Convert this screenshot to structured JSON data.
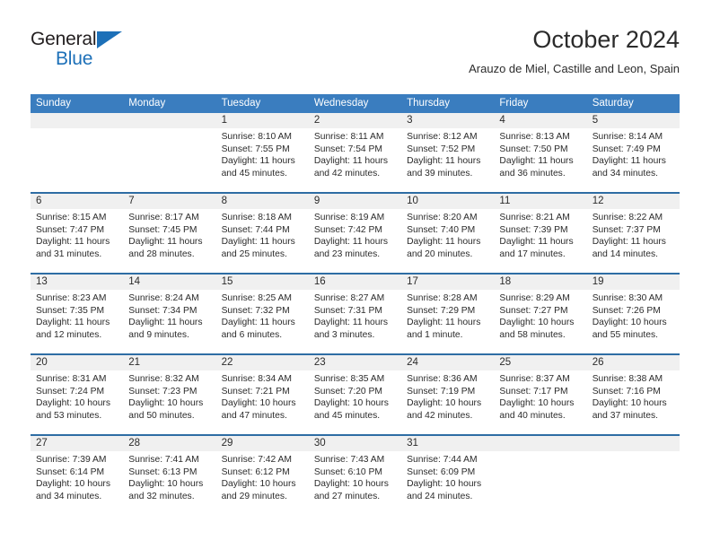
{
  "logo": {
    "word_top": "General",
    "word_bottom": "Blue",
    "triangle_color": "#1d70b8",
    "text_color": "#231f20"
  },
  "header": {
    "title": "October 2024",
    "subtitle": "Arauzo de Miel, Castille and Leon, Spain"
  },
  "theme": {
    "header_bg": "#3a7dbf",
    "header_text": "#ffffff",
    "row_divider": "#2e6da4",
    "daynum_band": "#f0f0f0",
    "body_text": "#2b2b2b"
  },
  "weekdays": [
    "Sunday",
    "Monday",
    "Tuesday",
    "Wednesday",
    "Thursday",
    "Friday",
    "Saturday"
  ],
  "weeks": [
    [
      {
        "day": "",
        "empty": true,
        "sunrise": "",
        "sunset": "",
        "daylight_line1": "",
        "daylight_line2": ""
      },
      {
        "day": "",
        "empty": true,
        "sunrise": "",
        "sunset": "",
        "daylight_line1": "",
        "daylight_line2": ""
      },
      {
        "day": "1",
        "sunrise": "Sunrise: 8:10 AM",
        "sunset": "Sunset: 7:55 PM",
        "daylight_line1": "Daylight: 11 hours",
        "daylight_line2": "and 45 minutes."
      },
      {
        "day": "2",
        "sunrise": "Sunrise: 8:11 AM",
        "sunset": "Sunset: 7:54 PM",
        "daylight_line1": "Daylight: 11 hours",
        "daylight_line2": "and 42 minutes."
      },
      {
        "day": "3",
        "sunrise": "Sunrise: 8:12 AM",
        "sunset": "Sunset: 7:52 PM",
        "daylight_line1": "Daylight: 11 hours",
        "daylight_line2": "and 39 minutes."
      },
      {
        "day": "4",
        "sunrise": "Sunrise: 8:13 AM",
        "sunset": "Sunset: 7:50 PM",
        "daylight_line1": "Daylight: 11 hours",
        "daylight_line2": "and 36 minutes."
      },
      {
        "day": "5",
        "sunrise": "Sunrise: 8:14 AM",
        "sunset": "Sunset: 7:49 PM",
        "daylight_line1": "Daylight: 11 hours",
        "daylight_line2": "and 34 minutes."
      }
    ],
    [
      {
        "day": "6",
        "sunrise": "Sunrise: 8:15 AM",
        "sunset": "Sunset: 7:47 PM",
        "daylight_line1": "Daylight: 11 hours",
        "daylight_line2": "and 31 minutes."
      },
      {
        "day": "7",
        "sunrise": "Sunrise: 8:17 AM",
        "sunset": "Sunset: 7:45 PM",
        "daylight_line1": "Daylight: 11 hours",
        "daylight_line2": "and 28 minutes."
      },
      {
        "day": "8",
        "sunrise": "Sunrise: 8:18 AM",
        "sunset": "Sunset: 7:44 PM",
        "daylight_line1": "Daylight: 11 hours",
        "daylight_line2": "and 25 minutes."
      },
      {
        "day": "9",
        "sunrise": "Sunrise: 8:19 AM",
        "sunset": "Sunset: 7:42 PM",
        "daylight_line1": "Daylight: 11 hours",
        "daylight_line2": "and 23 minutes."
      },
      {
        "day": "10",
        "sunrise": "Sunrise: 8:20 AM",
        "sunset": "Sunset: 7:40 PM",
        "daylight_line1": "Daylight: 11 hours",
        "daylight_line2": "and 20 minutes."
      },
      {
        "day": "11",
        "sunrise": "Sunrise: 8:21 AM",
        "sunset": "Sunset: 7:39 PM",
        "daylight_line1": "Daylight: 11 hours",
        "daylight_line2": "and 17 minutes."
      },
      {
        "day": "12",
        "sunrise": "Sunrise: 8:22 AM",
        "sunset": "Sunset: 7:37 PM",
        "daylight_line1": "Daylight: 11 hours",
        "daylight_line2": "and 14 minutes."
      }
    ],
    [
      {
        "day": "13",
        "sunrise": "Sunrise: 8:23 AM",
        "sunset": "Sunset: 7:35 PM",
        "daylight_line1": "Daylight: 11 hours",
        "daylight_line2": "and 12 minutes."
      },
      {
        "day": "14",
        "sunrise": "Sunrise: 8:24 AM",
        "sunset": "Sunset: 7:34 PM",
        "daylight_line1": "Daylight: 11 hours",
        "daylight_line2": "and 9 minutes."
      },
      {
        "day": "15",
        "sunrise": "Sunrise: 8:25 AM",
        "sunset": "Sunset: 7:32 PM",
        "daylight_line1": "Daylight: 11 hours",
        "daylight_line2": "and 6 minutes."
      },
      {
        "day": "16",
        "sunrise": "Sunrise: 8:27 AM",
        "sunset": "Sunset: 7:31 PM",
        "daylight_line1": "Daylight: 11 hours",
        "daylight_line2": "and 3 minutes."
      },
      {
        "day": "17",
        "sunrise": "Sunrise: 8:28 AM",
        "sunset": "Sunset: 7:29 PM",
        "daylight_line1": "Daylight: 11 hours",
        "daylight_line2": "and 1 minute."
      },
      {
        "day": "18",
        "sunrise": "Sunrise: 8:29 AM",
        "sunset": "Sunset: 7:27 PM",
        "daylight_line1": "Daylight: 10 hours",
        "daylight_line2": "and 58 minutes."
      },
      {
        "day": "19",
        "sunrise": "Sunrise: 8:30 AM",
        "sunset": "Sunset: 7:26 PM",
        "daylight_line1": "Daylight: 10 hours",
        "daylight_line2": "and 55 minutes."
      }
    ],
    [
      {
        "day": "20",
        "sunrise": "Sunrise: 8:31 AM",
        "sunset": "Sunset: 7:24 PM",
        "daylight_line1": "Daylight: 10 hours",
        "daylight_line2": "and 53 minutes."
      },
      {
        "day": "21",
        "sunrise": "Sunrise: 8:32 AM",
        "sunset": "Sunset: 7:23 PM",
        "daylight_line1": "Daylight: 10 hours",
        "daylight_line2": "and 50 minutes."
      },
      {
        "day": "22",
        "sunrise": "Sunrise: 8:34 AM",
        "sunset": "Sunset: 7:21 PM",
        "daylight_line1": "Daylight: 10 hours",
        "daylight_line2": "and 47 minutes."
      },
      {
        "day": "23",
        "sunrise": "Sunrise: 8:35 AM",
        "sunset": "Sunset: 7:20 PM",
        "daylight_line1": "Daylight: 10 hours",
        "daylight_line2": "and 45 minutes."
      },
      {
        "day": "24",
        "sunrise": "Sunrise: 8:36 AM",
        "sunset": "Sunset: 7:19 PM",
        "daylight_line1": "Daylight: 10 hours",
        "daylight_line2": "and 42 minutes."
      },
      {
        "day": "25",
        "sunrise": "Sunrise: 8:37 AM",
        "sunset": "Sunset: 7:17 PM",
        "daylight_line1": "Daylight: 10 hours",
        "daylight_line2": "and 40 minutes."
      },
      {
        "day": "26",
        "sunrise": "Sunrise: 8:38 AM",
        "sunset": "Sunset: 7:16 PM",
        "daylight_line1": "Daylight: 10 hours",
        "daylight_line2": "and 37 minutes."
      }
    ],
    [
      {
        "day": "27",
        "sunrise": "Sunrise: 7:39 AM",
        "sunset": "Sunset: 6:14 PM",
        "daylight_line1": "Daylight: 10 hours",
        "daylight_line2": "and 34 minutes."
      },
      {
        "day": "28",
        "sunrise": "Sunrise: 7:41 AM",
        "sunset": "Sunset: 6:13 PM",
        "daylight_line1": "Daylight: 10 hours",
        "daylight_line2": "and 32 minutes."
      },
      {
        "day": "29",
        "sunrise": "Sunrise: 7:42 AM",
        "sunset": "Sunset: 6:12 PM",
        "daylight_line1": "Daylight: 10 hours",
        "daylight_line2": "and 29 minutes."
      },
      {
        "day": "30",
        "sunrise": "Sunrise: 7:43 AM",
        "sunset": "Sunset: 6:10 PM",
        "daylight_line1": "Daylight: 10 hours",
        "daylight_line2": "and 27 minutes."
      },
      {
        "day": "31",
        "sunrise": "Sunrise: 7:44 AM",
        "sunset": "Sunset: 6:09 PM",
        "daylight_line1": "Daylight: 10 hours",
        "daylight_line2": "and 24 minutes."
      },
      {
        "day": "",
        "empty": true,
        "sunrise": "",
        "sunset": "",
        "daylight_line1": "",
        "daylight_line2": ""
      },
      {
        "day": "",
        "empty": true,
        "sunrise": "",
        "sunset": "",
        "daylight_line1": "",
        "daylight_line2": ""
      }
    ]
  ]
}
